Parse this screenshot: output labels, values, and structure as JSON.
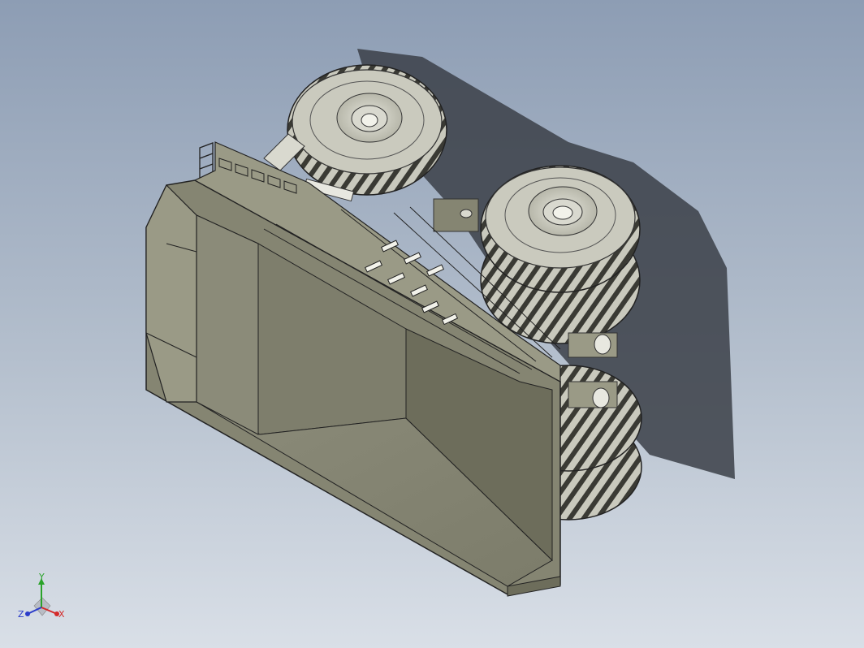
{
  "viewport": {
    "background_top": "#8d9db4",
    "background_bottom": "#d9dfe7"
  },
  "model": {
    "body_color": "#858572",
    "body_dark": "#6d6d5b",
    "body_light": "#9a9a86",
    "tire_color": "#c9c9bd",
    "shadow_color": "#3b4048"
  },
  "triad": {
    "y_label": "Y",
    "x_label": "X",
    "z_label": "Z",
    "y_color": "#2aa32a",
    "x_color": "#d42a2a",
    "z_color": "#2a3cc9"
  }
}
